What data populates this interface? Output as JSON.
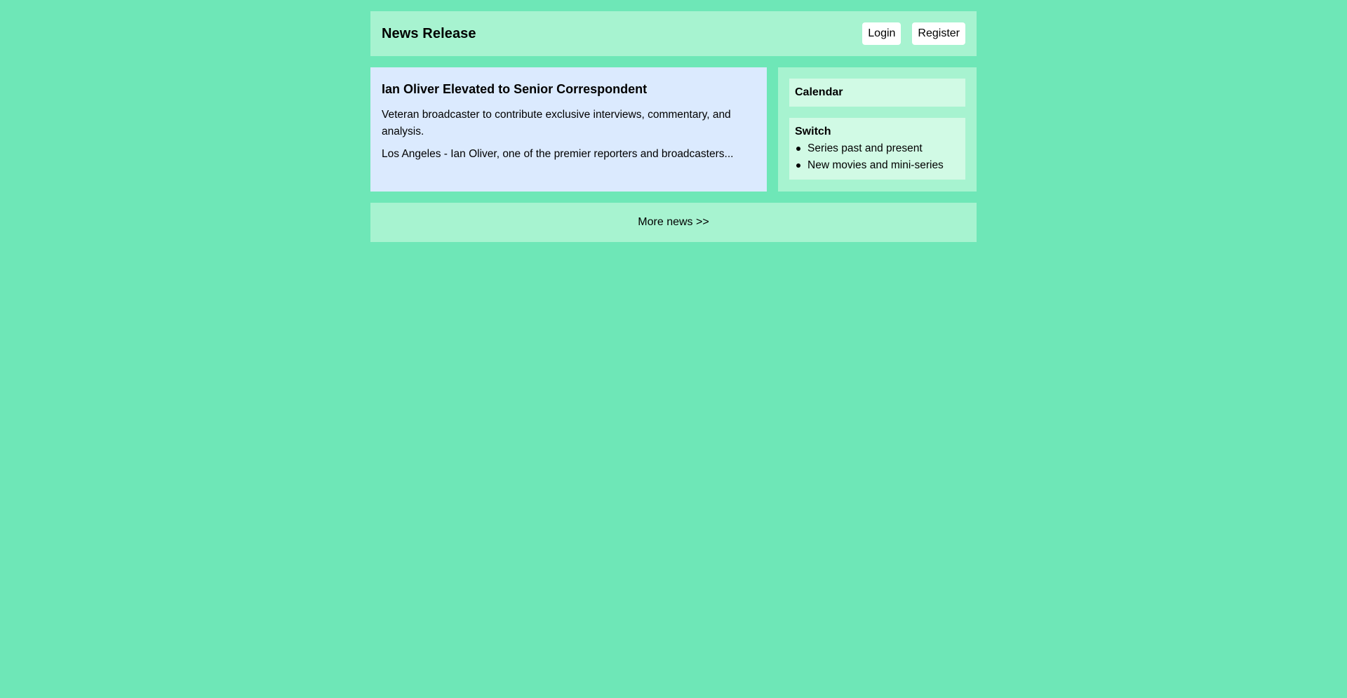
{
  "header": {
    "title": "News Release",
    "login_label": "Login",
    "register_label": "Register"
  },
  "article": {
    "title": "Ian Oliver Elevated to Senior Correspondent",
    "subtitle": "Veteran broadcaster to contribute exclusive interviews, commentary, and analysis.",
    "excerpt": "Los Angeles - Ian Oliver, one of the premier reporters and broadcasters..."
  },
  "sidebar": {
    "calendar_title": "Calendar",
    "switch_title": "Switch",
    "switch_items": [
      {
        "label": "Series past and present"
      },
      {
        "label": "New movies and mini-series"
      }
    ]
  },
  "footer": {
    "more_news_label": "More news >>"
  },
  "colors": {
    "page_background": "#6ee7b7",
    "panel_background": "#a7f3d0",
    "article_background": "#dbeafe",
    "widget_background": "#d1fae5"
  }
}
